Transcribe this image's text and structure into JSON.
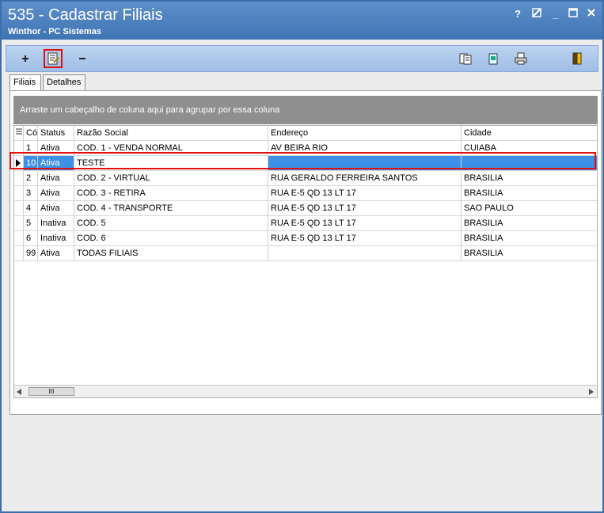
{
  "window": {
    "title": "535 - Cadastrar Filiais",
    "subtitle": "Winthor - PC Sistemas",
    "controls": {
      "help": "?",
      "minimize": "_"
    }
  },
  "toolbar": {
    "buttons": [
      {
        "name": "add-button",
        "icon": "plus-icon"
      },
      {
        "name": "edit-button",
        "icon": "edit-document-icon"
      },
      {
        "name": "remove-button",
        "icon": "minus-icon"
      },
      {
        "name": "copy-button",
        "icon": "copy-icon"
      },
      {
        "name": "calendar-button",
        "icon": "calendar-icon"
      },
      {
        "name": "print-button",
        "icon": "printer-icon"
      },
      {
        "name": "exit-button",
        "icon": "exit-door-icon"
      }
    ]
  },
  "tabs": [
    {
      "label": "Filiais",
      "active": true
    },
    {
      "label": "Detalhes",
      "active": false
    }
  ],
  "grid": {
    "group_hint": "Arraste um cabeçalho de coluna aqui para agrupar por essa coluna",
    "columns": [
      "Có",
      "Status",
      "Razão Social",
      "Endereço",
      "Cidade"
    ],
    "rows": [
      {
        "codigo": "1",
        "status": "Ativa",
        "razao": "COD. 1 - VENDA NORMAL",
        "endereco": "AV BEIRA RIO",
        "cidade": "CUIABA"
      },
      {
        "codigo": "10",
        "status": "Ativa",
        "razao": "TESTE",
        "endereco": "",
        "cidade": ""
      },
      {
        "codigo": "2",
        "status": "Ativa",
        "razao": "COD. 2 - VIRTUAL",
        "endereco": "RUA GERALDO FERREIRA SANTOS",
        "cidade": "BRASILIA"
      },
      {
        "codigo": "3",
        "status": "Ativa",
        "razao": "COD. 3 - RETIRA",
        "endereco": "RUA E-5 QD 13 LT 17",
        "cidade": "BRASILIA"
      },
      {
        "codigo": "4",
        "status": "Ativa",
        "razao": "COD. 4 - TRANSPORTE",
        "endereco": "RUA E-5 QD 13 LT 17",
        "cidade": "SAO PAULO"
      },
      {
        "codigo": "5",
        "status": "Inativa",
        "razao": "COD. 5",
        "endereco": "RUA E-5 QD 13 LT 17",
        "cidade": "BRASILIA"
      },
      {
        "codigo": "6",
        "status": "Inativa",
        "razao": "COD. 6",
        "endereco": "RUA E-5 QD 13 LT 17",
        "cidade": "BRASILIA"
      },
      {
        "codigo": "99",
        "status": "Ativa",
        "razao": "TODAS FILIAIS",
        "endereco": "",
        "cidade": "BRASILIA"
      }
    ],
    "selected_row_index": 1,
    "scroll_thumb_label": "III"
  },
  "colors": {
    "title_bar": "#3f74b4",
    "selection": "#3c91e6",
    "highlight_outline": "#e01010"
  }
}
